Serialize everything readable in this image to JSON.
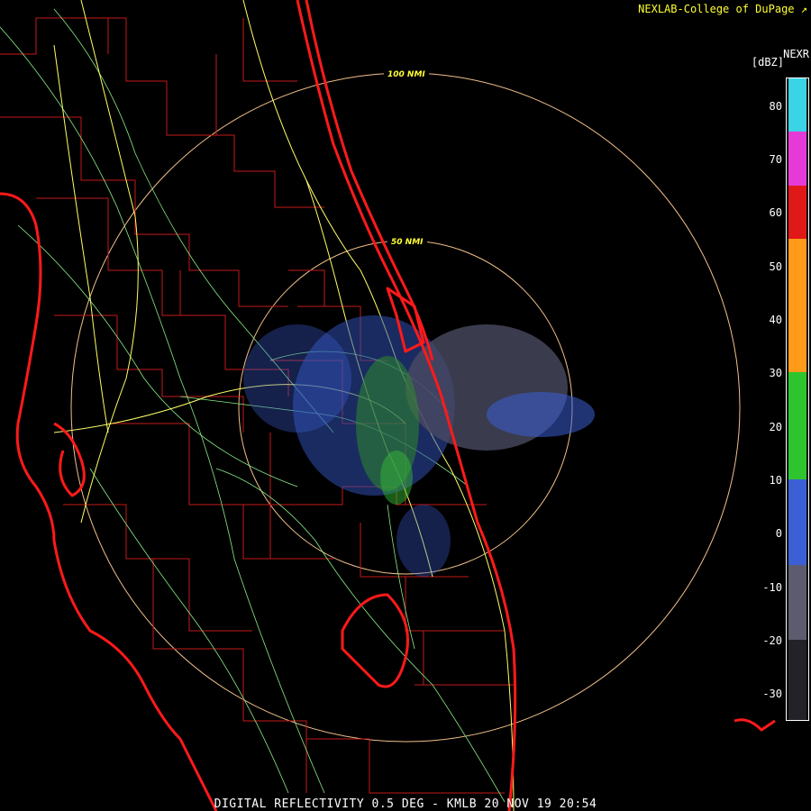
{
  "header": {
    "credit": "NEXLAB-College of DuPage",
    "product": "NEXR",
    "units": "[dBZ]"
  },
  "footer": {
    "caption": "DIGITAL REFLECTIVITY 0.5 DEG - KMLB 20 NOV 19 20:54"
  },
  "range_rings": [
    {
      "label": "50 NMI"
    },
    {
      "label": "100 NMI"
    }
  ],
  "color_scale": {
    "ticks": [
      "80",
      "70",
      "60",
      "50",
      "40",
      "30",
      "20",
      "10",
      "0",
      "-10",
      "-20",
      "-30"
    ],
    "bands": [
      {
        "from": 75,
        "to": 85,
        "color": "#3ad4e6"
      },
      {
        "from": 65,
        "to": 75,
        "color": "#e63ad8"
      },
      {
        "from": 55,
        "to": 65,
        "color": "#e01818"
      },
      {
        "from": 30,
        "to": 55,
        "color": "#ff9a1a"
      },
      {
        "from": 10,
        "to": 30,
        "color": "#2ec42e"
      },
      {
        "from": -6,
        "to": 10,
        "color": "#3b5fd4"
      },
      {
        "from": -20,
        "to": -6,
        "color": "#5c5c6e"
      },
      {
        "from": -35,
        "to": -20,
        "color": "#222228"
      }
    ]
  },
  "legend_icon": "external-link-icon",
  "colors": {
    "coastline": "#ff1a1a",
    "counties": "#c41a1a",
    "highways": "#ffff66",
    "roads": "#88ee88",
    "rings": "#f2c08a"
  }
}
